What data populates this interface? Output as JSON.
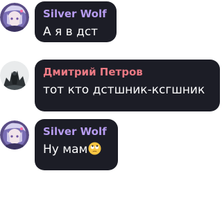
{
  "colors": {
    "bubble": "#1c1d26",
    "name_violet": "#b79cf0",
    "name_red": "#ec7a84",
    "text": "#ffffff"
  },
  "messages": [
    {
      "author": "Silver Wolf",
      "text": "А я в дст",
      "avatar": "silver-wolf-avatar"
    },
    {
      "author": "Дмитрий Петров",
      "text": "тот кто дстшник-ксгшник",
      "avatar": "dark-figure-avatar"
    },
    {
      "author": "Silver Wolf",
      "text": "Ну мам",
      "avatar": "silver-wolf-avatar",
      "emoji": "face-with-rolling-eyes-emoji"
    }
  ]
}
